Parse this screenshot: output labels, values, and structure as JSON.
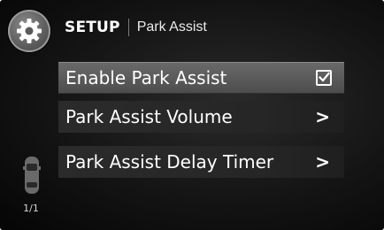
{
  "header": {
    "title": "SETUP",
    "subtitle": "Park Assist"
  },
  "menu": {
    "items": [
      {
        "label": "Enable Park Assist",
        "control": "checkbox",
        "checked": true,
        "selected": true
      },
      {
        "label": "Park Assist Volume",
        "control": "chevron",
        "chevron": ">"
      },
      {
        "label": "Park Assist Delay Timer",
        "control": "chevron",
        "chevron": ">"
      }
    ]
  },
  "page_indicator": "1/1",
  "icons": {
    "settings": "gear-icon",
    "vehicle": "car-icon",
    "check": "checkmark-icon"
  },
  "colors": {
    "background": "#141414",
    "selected_row": "#5a5a5a",
    "text": "#ffffff"
  }
}
